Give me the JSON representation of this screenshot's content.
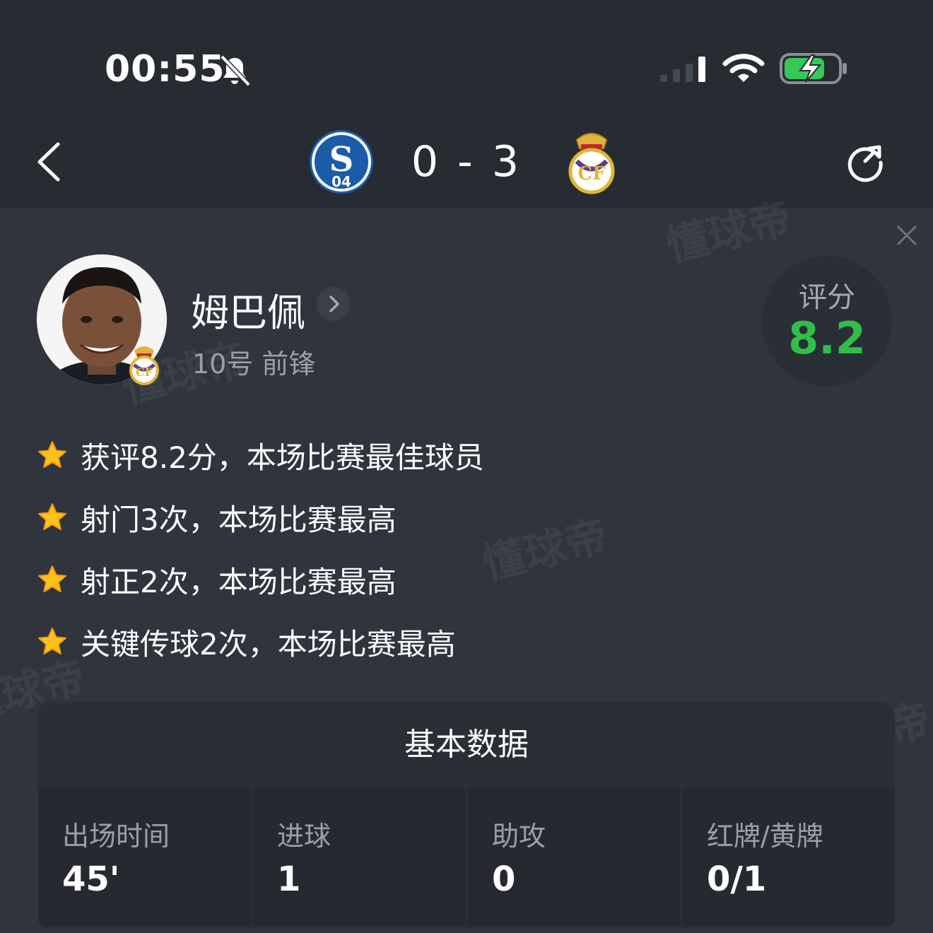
{
  "status_bar": {
    "time": "00:55"
  },
  "match": {
    "home_team_icon": "schalke-04-crest",
    "away_team_icon": "real-madrid-crest",
    "score": "0 - 3"
  },
  "player": {
    "name": "姆巴佩",
    "number_position": "10号 前锋",
    "rating_label": "评分",
    "rating_value": "8.2",
    "rating_color": "#2fbf4a"
  },
  "highlights": [
    {
      "icon": "star-icon",
      "text": "获评8.2分，本场比赛最佳球员"
    },
    {
      "icon": "star-icon",
      "text": "射门3次，本场比赛最高"
    },
    {
      "icon": "star-icon",
      "text": "射正2次，本场比赛最高"
    },
    {
      "icon": "star-icon",
      "text": "关键传球2次，本场比赛最高"
    }
  ],
  "stats": {
    "title": "基本数据",
    "items": [
      {
        "label": "出场时间",
        "value": "45'"
      },
      {
        "label": "进球",
        "value": "1"
      },
      {
        "label": "助攻",
        "value": "0"
      },
      {
        "label": "红牌/黄牌",
        "value": "0/1"
      }
    ]
  },
  "watermark_text": "懂球帝"
}
